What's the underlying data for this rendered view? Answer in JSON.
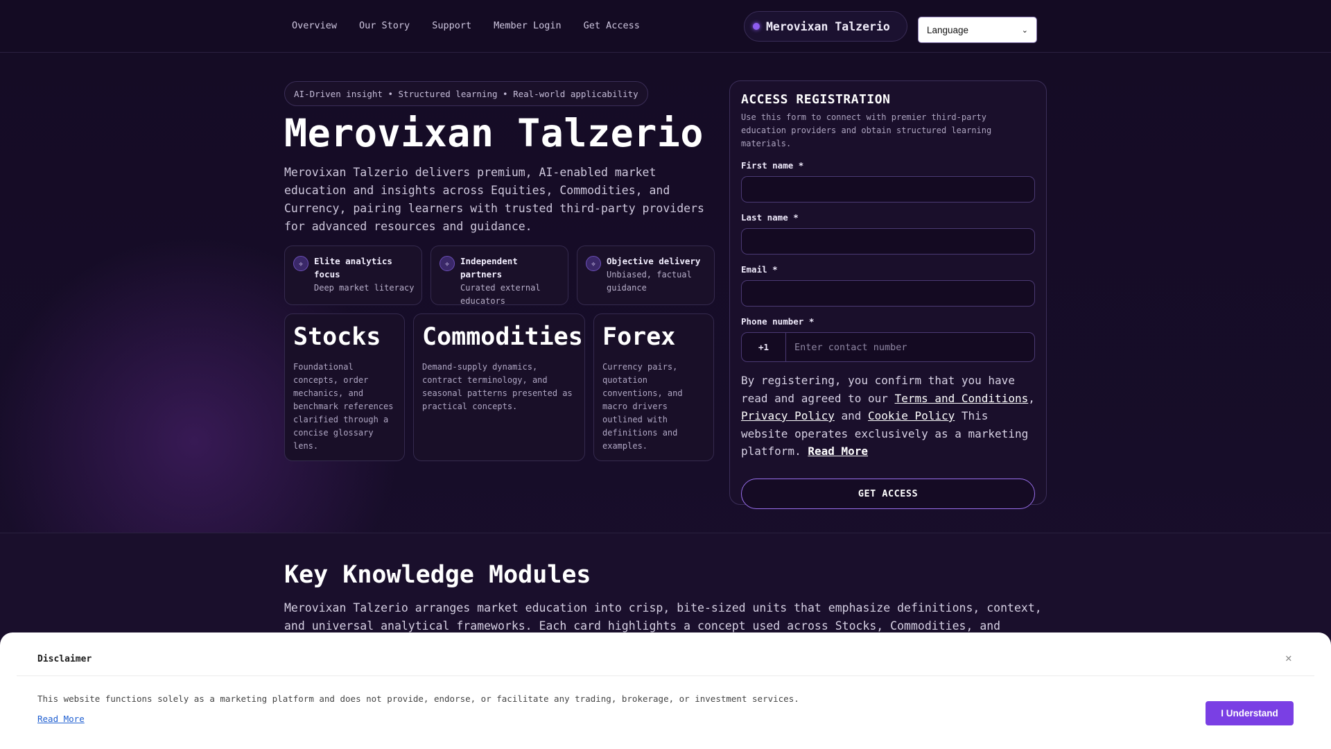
{
  "nav": {
    "links": [
      "Overview",
      "Our Story",
      "Support",
      "Member Login",
      "Get Access"
    ],
    "brand": "Merovixan Talzerio",
    "language_label": "Language"
  },
  "hero": {
    "tagline": "AI-Driven insight • Structured learning • Real-world applicability",
    "title": "Merovixan Talzerio",
    "description": "Merovixan Talzerio delivers premium, AI-enabled market education and insights across Equities, Commodities, and Currency, pairing learners with trusted third-party providers for advanced resources and guidance.",
    "features": [
      {
        "title": "Elite analytics focus",
        "subtitle": "Deep market literacy",
        "icon": "sparkle-icon"
      },
      {
        "title": "Independent partners",
        "subtitle": "Curated external educators",
        "icon": "sparkle-icon"
      },
      {
        "title": "Objective delivery",
        "subtitle": "Unbiased, factual guidance",
        "icon": "sparkle-icon"
      }
    ],
    "markets": [
      {
        "title": "Stocks",
        "description": "Foundational concepts, order mechanics, and benchmark references clarified through a concise glossary lens."
      },
      {
        "title": "Commodities",
        "description": "Demand-supply dynamics, contract terminology, and seasonal patterns presented as practical concepts."
      },
      {
        "title": "Forex",
        "description": "Currency pairs, quotation conventions, and macro drivers outlined with definitions and examples."
      }
    ]
  },
  "form": {
    "title": "ACCESS REGISTRATION",
    "subtitle": "Use this form to connect with premier third-party education providers and obtain structured learning materials.",
    "first_name_label": "First name *",
    "last_name_label": "Last name *",
    "email_label": "Email *",
    "phone_label": "Phone number *",
    "phone_code": "+1",
    "phone_placeholder": "Enter contact number",
    "consent_prefix": "By registering, you confirm that you have read and agreed to our ",
    "terms_link": "Terms and Conditions",
    "sep1": ", ",
    "privacy_link": "Privacy Policy",
    "sep2": " and ",
    "cookie_link": "Cookie Policy",
    "consent_suffix": " This website operates exclusively as a marketing platform. ",
    "read_more": "Read More",
    "submit_label": "GET ACCESS"
  },
  "modules": {
    "title": "Key Knowledge Modules",
    "description": "Merovixan Talzerio arranges market education into crisp, bite-sized units that emphasize definitions, context, and universal analytical frameworks. Each card highlights a concept used across Stocks, Commodities, and"
  },
  "disclaimer": {
    "title": "Disclaimer",
    "text": "This website functions solely as a marketing platform and does not provide, endorse, or facilitate any trading, brokerage, or investment services.",
    "read_more": "Read More",
    "button": "I Understand"
  },
  "colors": {
    "background": "#130b22",
    "accent": "#7a3fe4",
    "brand_dot": "#8d5cf0"
  }
}
